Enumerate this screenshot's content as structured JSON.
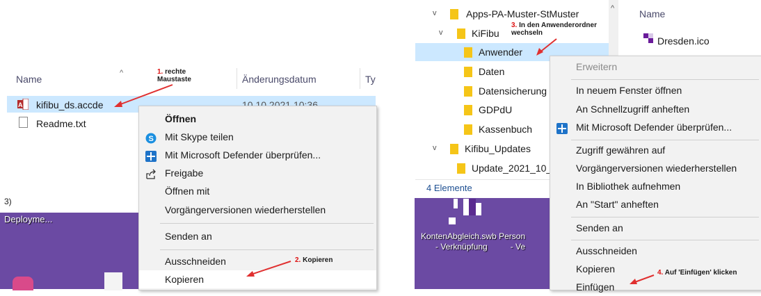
{
  "left": {
    "header": {
      "name": "Name",
      "date": "Änderungsdatum",
      "type_short": "Ty"
    },
    "files": [
      {
        "name": "kifibu_ds.accde",
        "date": "10.10.2021 10:36"
      },
      {
        "name": "Readme.txt"
      }
    ],
    "bottom_fragment": "3)",
    "desktop_label": "Deployme...",
    "menu": {
      "items": [
        "Öffnen",
        "Mit Skype teilen",
        "Mit Microsoft Defender überprüfen...",
        "Freigabe",
        "Öffnen mit",
        "Vorgängerversionen wiederherstellen",
        "Senden an",
        "Ausschneiden",
        "Kopieren"
      ]
    },
    "annotations": {
      "a1_num": "1.",
      "a1_line1": "rechte",
      "a1_line2": "Maustaste",
      "a2_num": "2.",
      "a2_text": "Kopieren"
    }
  },
  "right": {
    "tree": [
      {
        "label": "Apps-PA-Muster-StMuster"
      },
      {
        "label": "KiFibu"
      },
      {
        "label": "Anwender"
      },
      {
        "label": "Daten"
      },
      {
        "label": "Datensicherung"
      },
      {
        "label": "GDPdU"
      },
      {
        "label": "Kassenbuch"
      },
      {
        "label": "Kifibu_Updates"
      },
      {
        "label": "Update_2021_10_"
      }
    ],
    "status": "4 Elemente",
    "pane": {
      "header": "Name",
      "file": "Dresden.ico"
    },
    "desktop": {
      "l1a": "KontenAbgleich.swb",
      "l1b": "Person",
      "l2a": "- Verknüpfung",
      "l2b": "- Ve"
    },
    "menu": {
      "items": [
        "Erweitern",
        "In neuem Fenster öffnen",
        "An Schnellzugriff anheften",
        "Mit Microsoft Defender überprüfen...",
        "Zugriff gewähren auf",
        "Vorgängerversionen wiederherstellen",
        "In Bibliothek aufnehmen",
        "An \"Start\" anheften",
        "Senden an",
        "Ausschneiden",
        "Kopieren",
        "Einfügen"
      ]
    },
    "annotations": {
      "a3_num": "3.",
      "a3_line1": "In den Anwenderordner",
      "a3_line2": "wechseln",
      "a4_num": "4.",
      "a4_text": "Auf 'Einfügen' klicken"
    }
  },
  "colors": {
    "selection": "#cce8ff",
    "desktop": "#6b4aa3",
    "arrow": "#e03030",
    "defender": "#1e73c8",
    "skype": "#1a8fe0"
  }
}
